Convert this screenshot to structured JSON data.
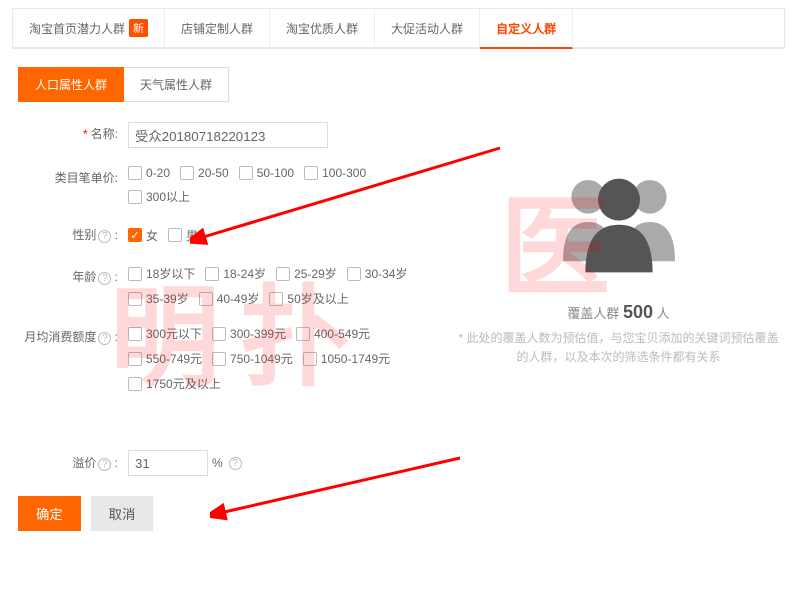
{
  "top_tabs": [
    {
      "label": "淘宝首页潜力人群",
      "badge": "新"
    },
    {
      "label": "店铺定制人群"
    },
    {
      "label": "淘宝优质人群"
    },
    {
      "label": "大促活动人群"
    },
    {
      "label": "自定义人群",
      "active": true
    }
  ],
  "sub_tabs": [
    {
      "label": "人口属性人群",
      "active": true
    },
    {
      "label": "天气属性人群"
    }
  ],
  "form": {
    "name_label": "名称:",
    "name_value": "受众20180718220123",
    "price_label": "类目笔单价:",
    "price_opts": [
      "0-20",
      "20-50",
      "50-100",
      "100-300",
      "300以上"
    ],
    "gender_label": "性别",
    "gender_opts": [
      {
        "t": "女",
        "on": true
      },
      {
        "t": "男"
      }
    ],
    "age_label": "年龄",
    "age_opts": [
      "18岁以下",
      "18-24岁",
      "25-29岁",
      "30-34岁",
      "35-39岁",
      "40-49岁",
      "50岁及以上"
    ],
    "spend_label": "月均消费额度",
    "spend_opts": [
      "300元以下",
      "300-399元",
      "400-549元",
      "550-749元",
      "750-1049元",
      "1050-1749元",
      "1750元及以上"
    ]
  },
  "coverage": {
    "text": "覆盖人群",
    "count": "500",
    "unit": "人",
    "tip": "* 此处的覆盖人数为预估值，与您宝贝添加的关键词预估覆盖的人群，以及本次的筛选条件都有关系"
  },
  "yijia": {
    "label": "溢价",
    "value": "31",
    "suffix": "%"
  },
  "btns": {
    "ok": "确定",
    "cancel": "取消"
  }
}
